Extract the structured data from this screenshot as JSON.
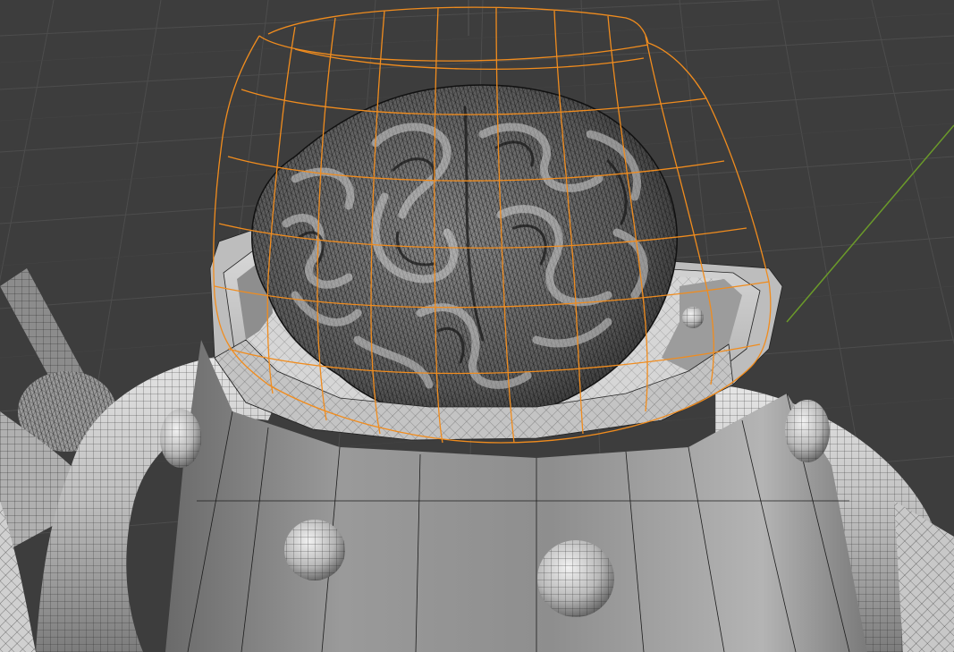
{
  "viewport": {
    "name": "3D Viewport",
    "shading": "solid-wireframe",
    "colors": {
      "background": "#3d3d3d",
      "grid_line": "#4a4a4a",
      "axis_y": "#6b9a2a",
      "selection_outline": "#f08c1e",
      "surface_light": "#c8c8c8",
      "surface_dark": "#6a6a6a",
      "wire": "#1e1e1e"
    }
  },
  "scene": {
    "objects": [
      {
        "name": "brain",
        "icon": "brain-mesh-icon",
        "selected": false
      },
      {
        "name": "glass-dome",
        "icon": "dome-icon",
        "selected": true
      },
      {
        "name": "robot-head-collar",
        "icon": "cylinder-icon",
        "selected": false
      },
      {
        "name": "torus-ring",
        "icon": "torus-icon",
        "selected": false
      },
      {
        "name": "rivet-spheres",
        "icon": "sphere-icon",
        "selected": false
      },
      {
        "name": "robot-arm",
        "icon": "arm-icon",
        "selected": false
      }
    ]
  }
}
